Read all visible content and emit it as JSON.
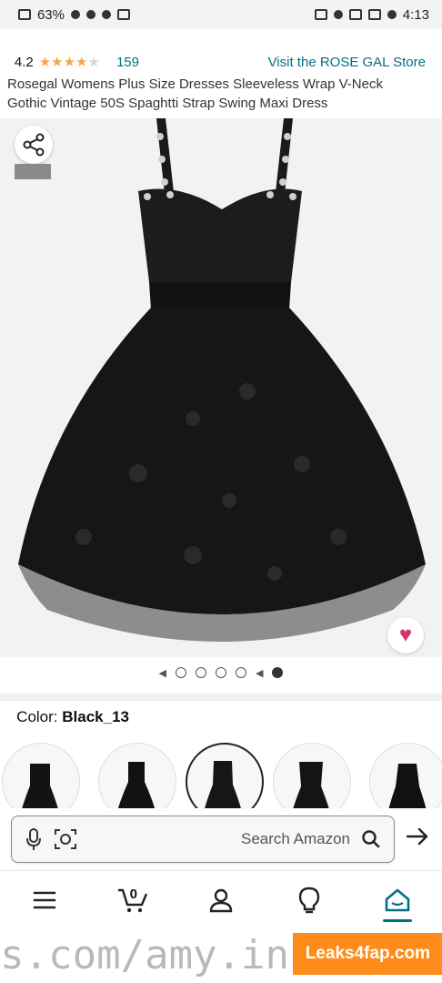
{
  "status_bar": {
    "time": "4:13",
    "battery": "63%"
  },
  "product": {
    "store_link": "Visit the ROSE GAL Store",
    "rating_value": "4.2",
    "rating_stars": 4.2,
    "rating_count": "159",
    "title": "Rosegal Womens Plus Size Dresses Sleeveless Wrap V-Neck Gothic Vintage 50S Spaghtti Strap Swing Maxi Dress"
  },
  "gallery": {
    "image_count": 5,
    "active_index": 0,
    "has_video": true
  },
  "variation": {
    "label": "Color:",
    "value": "Black_13"
  },
  "search": {
    "placeholder": "Search Amazon"
  },
  "bottom_nav": [
    "home-icon",
    "lightbulb-icon",
    "account-icon",
    "cart-icon",
    "menu-icon"
  ],
  "cart_count": "0",
  "watermark": {
    "url_text": "s.com/amy.insani",
    "brand": "Leaks4fap.com"
  },
  "colors": {
    "link": "#007185",
    "star": "#f3a847",
    "heart": "#d6336c",
    "watermark": "#ff8c1a"
  }
}
